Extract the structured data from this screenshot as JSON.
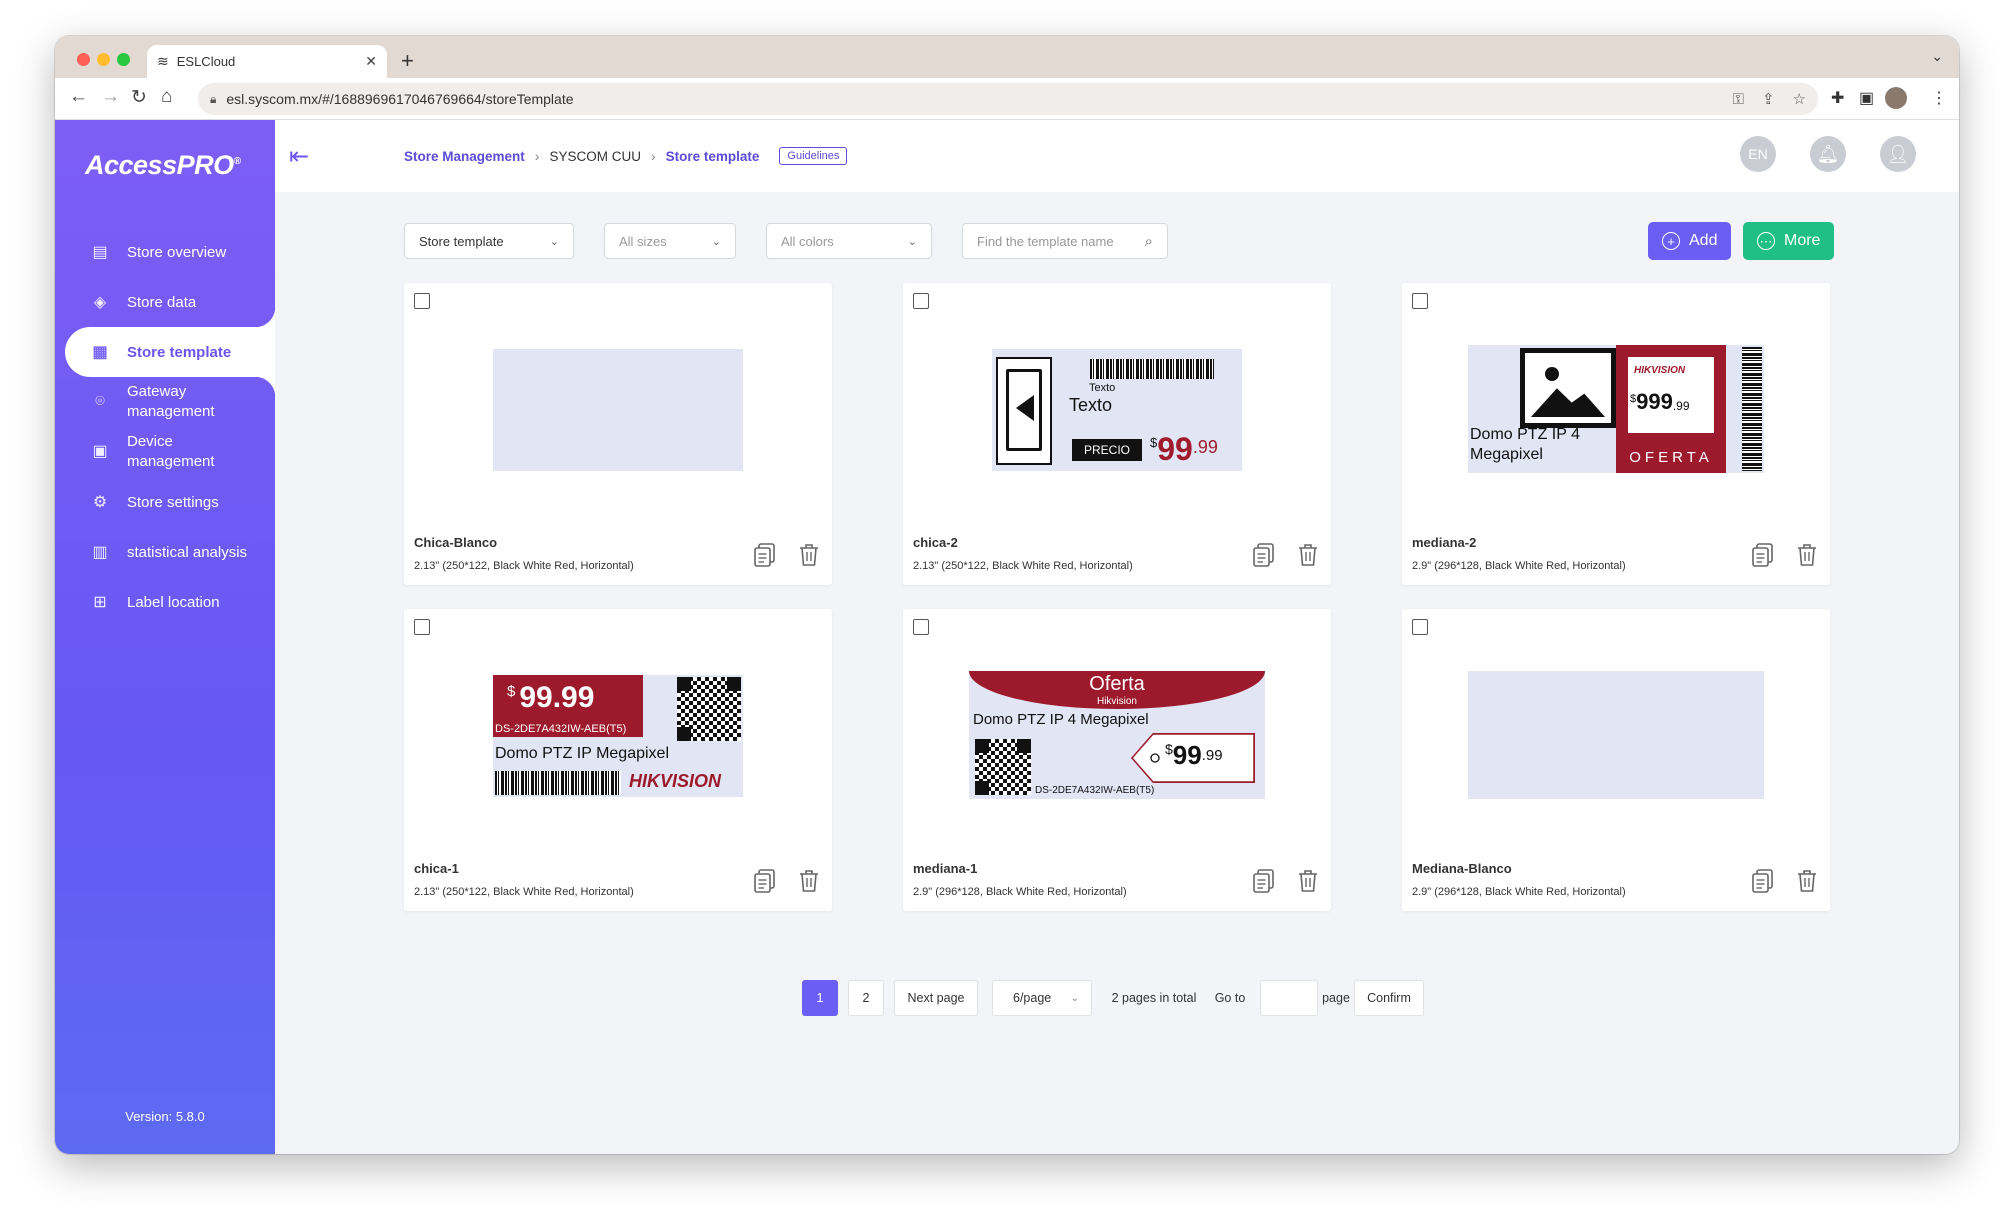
{
  "browser": {
    "tab_title": "ESLCloud",
    "url": "esl.syscom.mx/#/1688969617046769664/storeTemplate"
  },
  "sidebar": {
    "logo": "AccessPRO",
    "logo_mark": "®",
    "items": [
      {
        "label": "Store overview",
        "icon": "store-overview-icon"
      },
      {
        "label": "Store data",
        "icon": "cube-icon"
      },
      {
        "label": "Store template",
        "icon": "template-icon",
        "active": true
      },
      {
        "label": "Gateway management",
        "icon": "gateway-icon"
      },
      {
        "label": "Device management",
        "icon": "device-icon"
      },
      {
        "label": "Store settings",
        "icon": "store-settings-icon"
      },
      {
        "label": "statistical analysis",
        "icon": "chart-icon"
      },
      {
        "label": "Label location",
        "icon": "label-location-icon"
      }
    ],
    "version": "Version: 5.8.0"
  },
  "header": {
    "breadcrumb": [
      "Store Management",
      "SYSCOM CUU",
      "Store template"
    ],
    "guidelines": "Guidelines",
    "lang": "EN"
  },
  "filters": {
    "type": "Store template",
    "sizes_placeholder": "All sizes",
    "colors_placeholder": "All colors",
    "search_placeholder": "Find the template name",
    "add_label": "Add",
    "more_label": "More",
    "add_color": "#6b5ef4",
    "more_color": "#1fbf85"
  },
  "templates": [
    {
      "name": "Chica-Blanco",
      "desc": "2.13\" (250*122, Black White Red, Horizontal)"
    },
    {
      "name": "chica-2",
      "desc": "2.13\" (250*122, Black White Red, Horizontal)",
      "preview": {
        "label_small": "Texto",
        "label": "Texto",
        "price_tag": "PRECIO",
        "currency": "$",
        "price": "99",
        "cents": ".99"
      }
    },
    {
      "name": "mediana-2",
      "desc": "2.9\" (296*128, Black White Red, Horizontal)",
      "preview": {
        "brand": "HIKVISION",
        "currency": "$",
        "price": "999",
        "cents": ".99",
        "offer": "OFERTA",
        "product": "Domo PTZ IP 4 Megapixel"
      }
    },
    {
      "name": "chica-1",
      "desc": "2.13\" (250*122, Black White Red, Horizontal)",
      "preview": {
        "currency": "$",
        "price": "99.99",
        "sku": "DS-2DE7A432IW-AEB(T5)",
        "product": "Domo PTZ IP Megapixel",
        "brand": "HIKVISION"
      }
    },
    {
      "name": "mediana-1",
      "desc": "2.9\" (296*128, Black White Red, Horizontal)",
      "preview": {
        "offer": "Oferta",
        "brand": "Hikvision",
        "product": "Domo PTZ IP 4 Megapixel",
        "currency": "$",
        "price": "99",
        "cents": ".99",
        "sku": "DS-2DE7A432IW-AEB(T5)"
      }
    },
    {
      "name": "Mediana-Blanco",
      "desc": "2.9\" (296*128, Black White Red, Horizontal)"
    }
  ],
  "pagination": {
    "pages": [
      "1",
      "2"
    ],
    "current": "1",
    "next": "Next page",
    "page_size": "6/page",
    "total": "2 pages in total",
    "goto": "Go to",
    "page_word": "page",
    "confirm": "Confirm"
  }
}
